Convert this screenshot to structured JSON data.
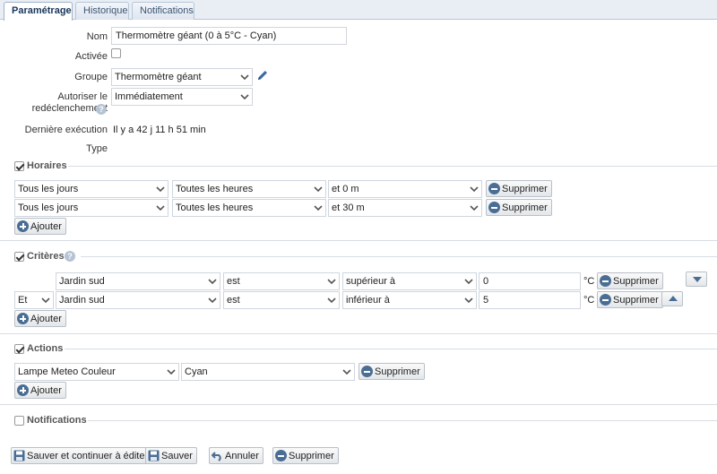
{
  "tabs": [
    {
      "label": "Paramétrage",
      "active": true
    },
    {
      "label": "Historique",
      "active": false
    },
    {
      "label": "Notifications",
      "active": false
    }
  ],
  "form": {
    "nom_label": "Nom",
    "nom_value": "Thermomètre géant (0 à 5°C - Cyan)",
    "activee_label": "Activée",
    "activee_checked": false,
    "groupe_label": "Groupe",
    "groupe_value": "Thermomètre géant",
    "autoriser_label_1": "Autoriser le",
    "autoriser_label_2": "redéclenchement",
    "autoriser_value": "Immédiatement",
    "derniere_label": "Dernière exécution",
    "derniere_value": "Il y a 42 j 11 h 51 min",
    "type_label": "Type"
  },
  "horaires": {
    "title": "Horaires",
    "checked": true,
    "rows": [
      {
        "days": "Tous les jours",
        "hours": "Toutes les heures",
        "minutes": "et 0 m",
        "delete": "Supprimer"
      },
      {
        "days": "Tous les jours",
        "hours": "Toutes les heures",
        "minutes": "et 30 m",
        "delete": "Supprimer"
      }
    ],
    "add": "Ajouter"
  },
  "criteres": {
    "title": "Critères",
    "checked": true,
    "rows": [
      {
        "conj": "",
        "device": "Jardin sud",
        "verb": "est",
        "op": "supérieur à",
        "value": "0",
        "unit": "°C",
        "delete": "Supprimer"
      },
      {
        "conj": "Et",
        "device": "Jardin sud",
        "verb": "est",
        "op": "inférieur à",
        "value": "5",
        "unit": "°C",
        "delete": "Supprimer"
      }
    ],
    "add": "Ajouter"
  },
  "actions": {
    "title": "Actions",
    "checked": true,
    "rows": [
      {
        "device": "Lampe Meteo Couleur",
        "value": "Cyan",
        "delete": "Supprimer"
      }
    ],
    "add": "Ajouter"
  },
  "notifications": {
    "title": "Notifications",
    "checked": false
  },
  "footer": {
    "save_continue": "Sauver et continuer à éditer",
    "save": "Sauver",
    "cancel": "Annuler",
    "delete": "Supprimer"
  },
  "colors": {
    "accent": "#4a6d94",
    "tabbar": "#e9eef5",
    "pencil": "#3f6aa0"
  }
}
